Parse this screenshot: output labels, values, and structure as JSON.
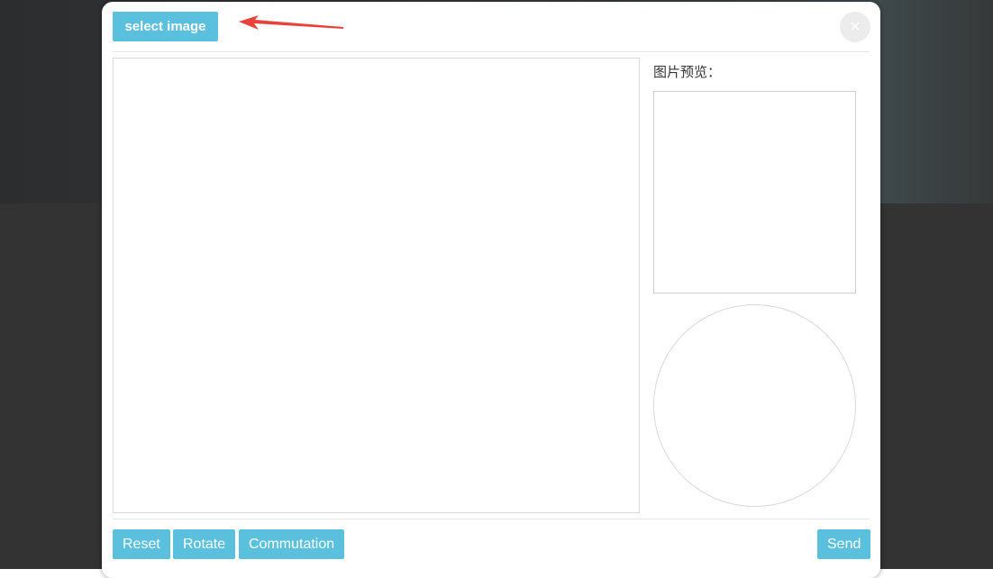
{
  "dialog": {
    "select_image_label": "select image",
    "close_label": "×",
    "preview_label": "图片预览："
  },
  "toolbar": {
    "reset_label": "Reset",
    "rotate_label": "Rotate",
    "commutation_label": "Commutation",
    "send_label": "Send"
  },
  "colors": {
    "button_accent": "#5bc0de",
    "annotation_arrow": "#e8423b",
    "backdrop": "#333333"
  },
  "icons": {
    "close": "close-icon",
    "annotation": "red-arrow-icon"
  }
}
